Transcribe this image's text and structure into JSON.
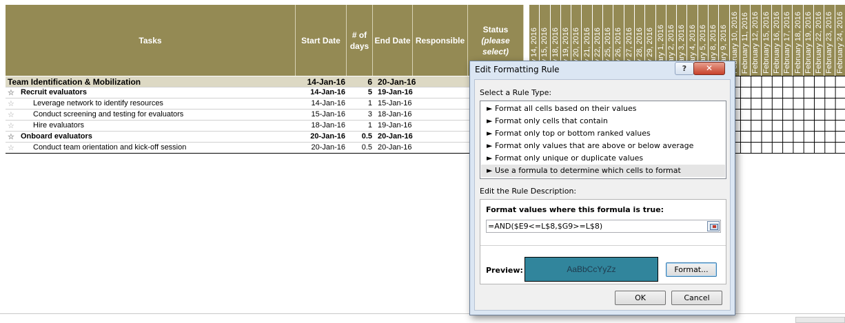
{
  "sheet": {
    "headers": {
      "tasks": "Tasks",
      "start": "Start Date",
      "days": "# of days",
      "end": "End Date",
      "responsible": "Responsible",
      "status_line1": "Status",
      "status_line2": "(please select)"
    },
    "date_columns": [
      "uary 14, 2016",
      "uary 15, 2016",
      "uary 18, 2016",
      "uary 19, 2016",
      "uary 20, 2016",
      "uary 21, 2016",
      "uary 22, 2016",
      "uary 25, 2016",
      "uary 26, 2016",
      "uary 27, 2016",
      "uary 28, 2016",
      "uary 29, 2016",
      "bruary 1, 2016",
      "bruary 2, 2016",
      "bruary 3, 2016",
      "bruary 4, 2016",
      "bruary 5, 2016",
      "bruary 8, 2016",
      "bruary 9, 2016",
      "February 10, 2016",
      "February 11, 2016",
      "February 12, 2016",
      "February 15, 2016",
      "February 16, 2016",
      "February 17, 2016",
      "February 18, 2016",
      "February 19, 2016",
      "February 22, 2016",
      "February 23, 2016",
      "February 24, 2016"
    ],
    "rows": [
      {
        "task": "Team Identification & Mobilization",
        "start": "14-Jan-16",
        "days": "6",
        "end": "20-Jan-16"
      },
      {
        "task": "Recruit evaluators",
        "start": "14-Jan-16",
        "days": "5",
        "end": "19-Jan-16"
      },
      {
        "task": "Leverage network to identify resources",
        "start": "14-Jan-16",
        "days": "1",
        "end": "15-Jan-16"
      },
      {
        "task": "Conduct screening and testing for evaluators",
        "start": "15-Jan-16",
        "days": "3",
        "end": "18-Jan-16"
      },
      {
        "task": "Hire evaluators",
        "start": "18-Jan-16",
        "days": "1",
        "end": "19-Jan-16"
      },
      {
        "task": "Onboard evaluators",
        "start": "20-Jan-16",
        "days": "0.5",
        "end": "20-Jan-16"
      },
      {
        "task": "Conduct team orientation and kick-off session",
        "start": "20-Jan-16",
        "days": "0.5",
        "end": "20-Jan-16"
      }
    ]
  },
  "dialog": {
    "title": "Edit Formatting Rule",
    "help_label": "?",
    "close_label": "✕",
    "rule_type_label": "Select a Rule Type:",
    "rule_types": [
      "► Format all cells based on their values",
      "► Format only cells that contain",
      "► Format only top or bottom ranked values",
      "► Format only values that are above or below average",
      "► Format only unique or duplicate values",
      "► Use a formula to determine which cells to format"
    ],
    "rule_desc_label": "Edit the Rule Description:",
    "formula_heading": "Format values where this formula is true:",
    "formula_value": "=AND($E9<=L$8,$G9>=L$8)",
    "preview_label": "Preview:",
    "preview_text": "AaBbCcYyZz",
    "preview_color": "#31859c",
    "format_button": "Format...",
    "ok_button": "OK",
    "cancel_button": "Cancel"
  }
}
